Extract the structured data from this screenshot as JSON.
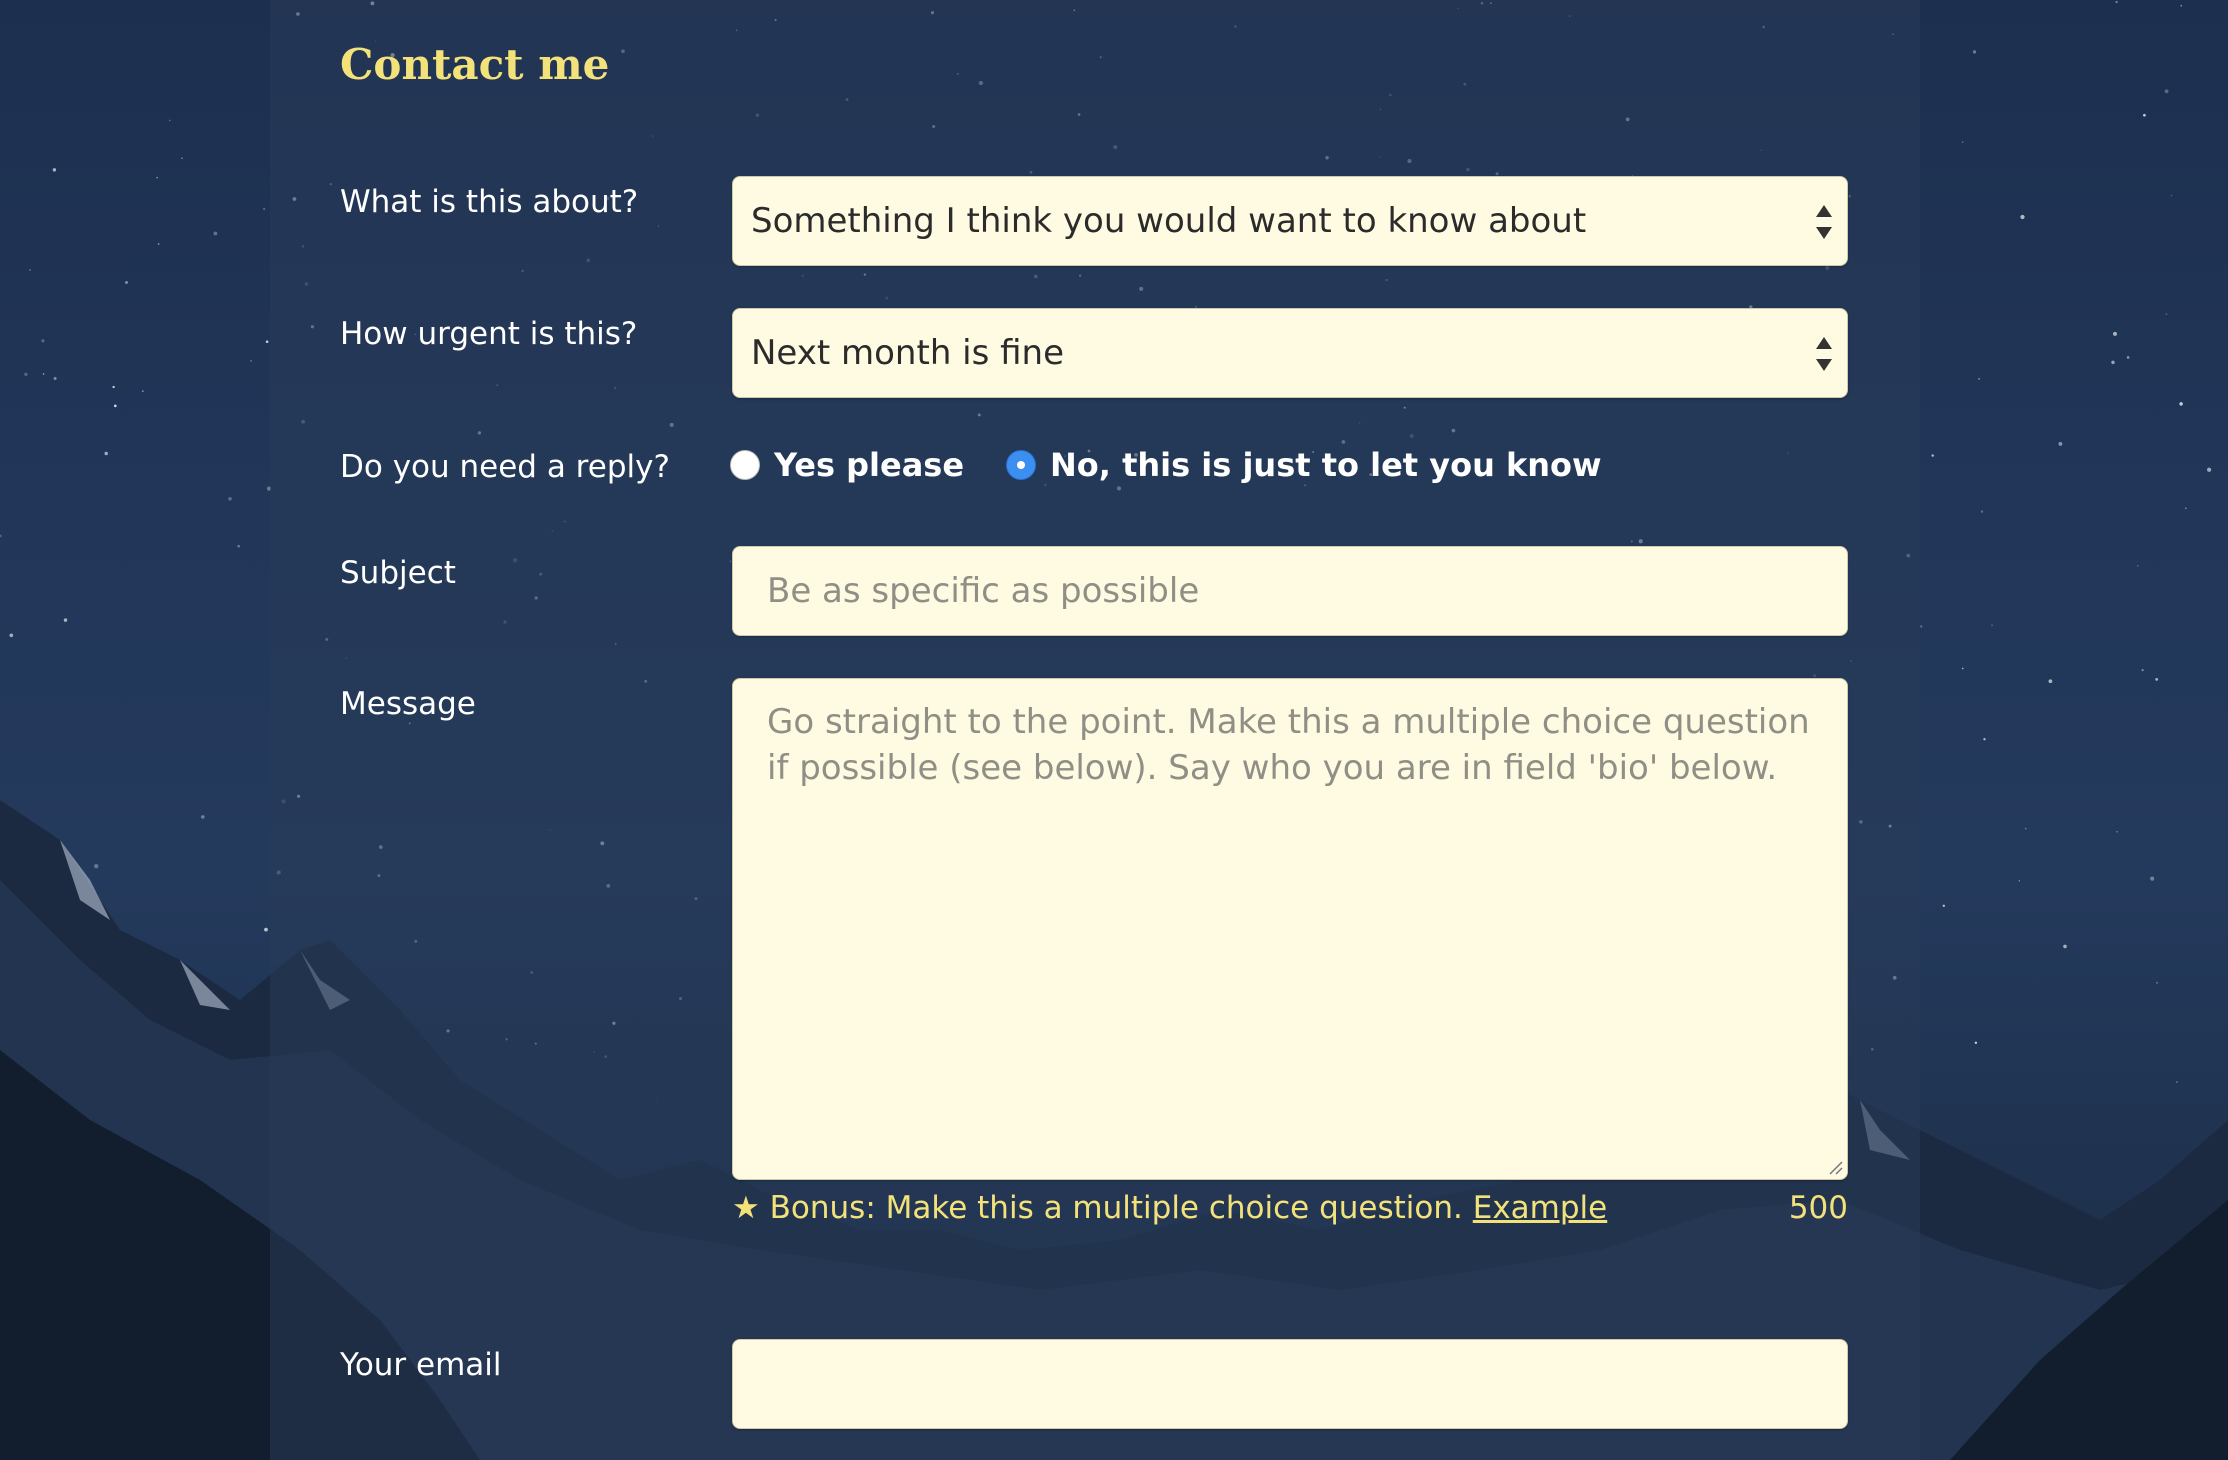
{
  "page": {
    "title": "Contact me"
  },
  "form": {
    "topic": {
      "label": "What is this about?",
      "value": "Something I think you would want to know about"
    },
    "urgency": {
      "label": "How urgent is this?",
      "value": "Next month is fine"
    },
    "reply": {
      "label": "Do you need a reply?",
      "options": [
        {
          "label": "Yes please",
          "selected": false
        },
        {
          "label": "No, this is just to let you know",
          "selected": true
        }
      ]
    },
    "subject": {
      "label": "Subject",
      "placeholder": "Be as specific as possible",
      "value": ""
    },
    "message": {
      "label": "Message",
      "placeholder": "Go straight to the point. Make this a multiple choice question if possible (see below). Say who you are in field 'bio' below.",
      "value": "",
      "bonus_text": "Bonus: Make this a multiple choice question.",
      "bonus_link": "Example",
      "char_count": "500"
    },
    "email": {
      "label": "Your email",
      "value": ""
    }
  },
  "icons": {
    "star": "star-icon",
    "select_arrows": "select-arrows-icon",
    "resize": "resize-handle-icon"
  },
  "colors": {
    "accent": "#f3e27a",
    "field_background": "#fffbe3",
    "radio_selected": "#3b8ff0"
  }
}
